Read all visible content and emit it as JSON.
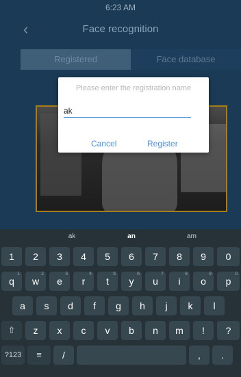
{
  "status_bar": {
    "time": "6:23 AM"
  },
  "header": {
    "back_icon": "chevron-left-icon",
    "title": "Face recognition"
  },
  "tabs": [
    {
      "label": "Registered"
    },
    {
      "label": "Face database"
    }
  ],
  "dialog": {
    "title": "Please enter the registration name",
    "input_value": "ak",
    "cancel_label": "Cancel",
    "register_label": "Register"
  },
  "keyboard": {
    "suggestions": [
      "ak",
      "an",
      "am"
    ],
    "row_numbers": [
      "1",
      "2",
      "3",
      "4",
      "5",
      "6",
      "7",
      "8",
      "9",
      "0"
    ],
    "row_q": [
      "q",
      "w",
      "e",
      "r",
      "t",
      "y",
      "u",
      "i",
      "o",
      "p"
    ],
    "row_q_hints": [
      "1",
      "2",
      "3",
      "4",
      "5",
      "6",
      "7",
      "8",
      "9",
      "0"
    ],
    "row_a": [
      "a",
      "s",
      "d",
      "f",
      "g",
      "h",
      "j",
      "k",
      "l"
    ],
    "row_z": [
      "z",
      "x",
      "c",
      "v",
      "b",
      "n",
      "m",
      "!",
      "?"
    ],
    "bottom": {
      "mode": "?123",
      "emoji_sym": "≡",
      "slash": "/",
      "comma": ",",
      "period": "."
    }
  }
}
